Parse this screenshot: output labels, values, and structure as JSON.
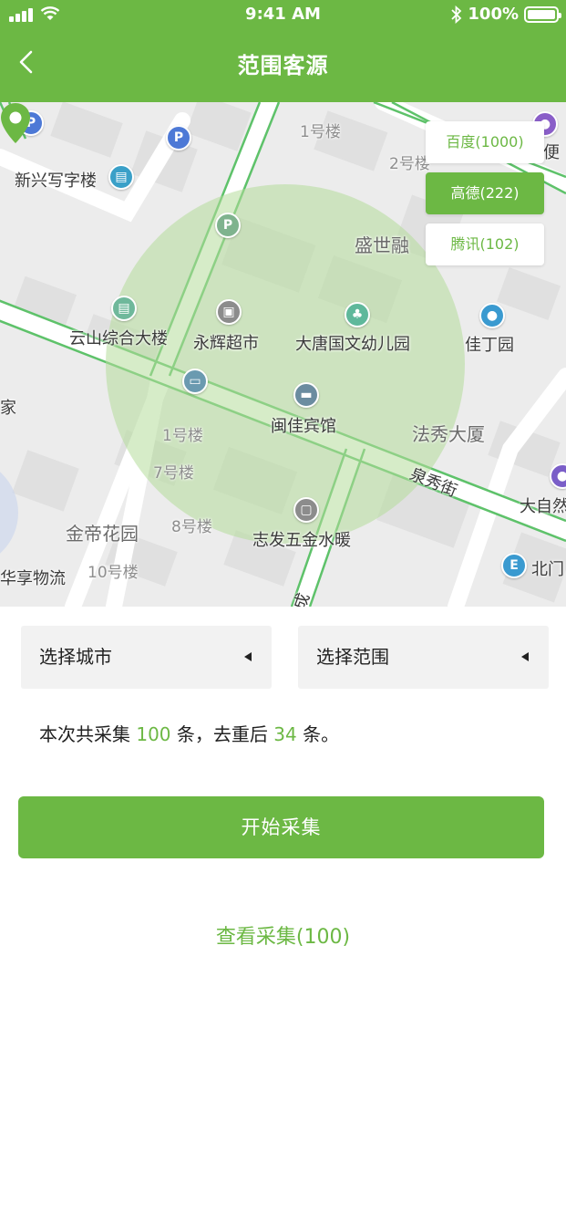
{
  "status_bar": {
    "time": "9:41 AM",
    "battery": "100%",
    "battery_level": 1.0
  },
  "header": {
    "title": "范围客源",
    "back_icon": "chevron-left-icon"
  },
  "map": {
    "labels": {
      "building_1": "1号楼",
      "building_2": "2号楼",
      "xinxing": "新兴写字楼",
      "shengshi": "盛世融",
      "yunshan": "云山综合大楼",
      "yonghui": "永辉超市",
      "datang": "大唐国文幼儿园",
      "jiading": "佳丁园",
      "jia": "家",
      "minjia": "闽佳宾馆",
      "faxiu_tower": "法秀大厦",
      "building_1b": "1号楼",
      "building_7": "7号楼",
      "quanxiu_street": "泉秀街",
      "jindi": "金帝花园",
      "building_8": "8号楼",
      "zhifa": "志发五金水暖",
      "huaxiang": "华享物流",
      "building_10": "10号楼",
      "cheng": "成",
      "daziran": "大自然",
      "beimen": "北门",
      "bian": "便"
    },
    "poi_letters": {
      "parking": "P"
    },
    "radius_color": "#b5dc9a",
    "pin_color": "#6cb844"
  },
  "providers": [
    {
      "label": "百度(1000)",
      "active": false
    },
    {
      "label": "高德(222)",
      "active": true
    },
    {
      "label": "腾讯(102)",
      "active": false
    }
  ],
  "controls": {
    "city_select": "选择城市",
    "range_select": "选择范围",
    "summary": {
      "prefix": "本次共采集 ",
      "total": "100",
      "middle": " 条，去重后 ",
      "dedup": "34",
      "suffix": " 条。"
    },
    "start_button": "开始采集",
    "view_link": "查看采集(100)"
  },
  "colors": {
    "brand": "#6cb844",
    "background": "#ffffff",
    "select_bg": "#f2f2f2"
  }
}
